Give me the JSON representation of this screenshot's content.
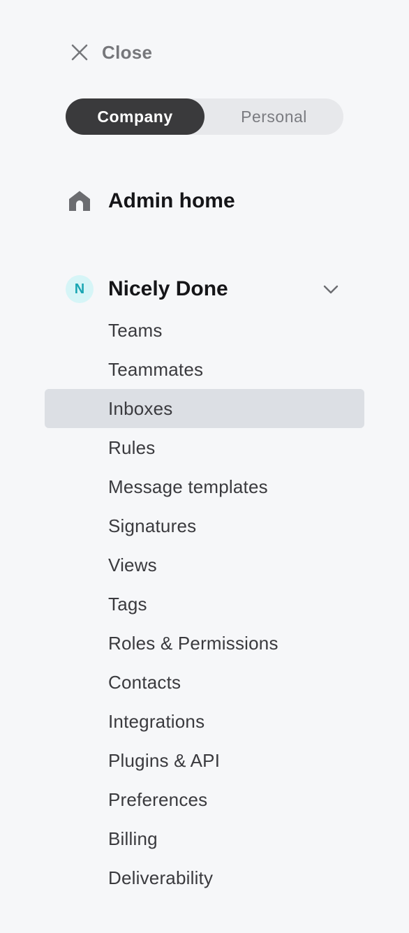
{
  "close": {
    "label": "Close",
    "icon": "close-icon"
  },
  "scope_toggle": {
    "options": [
      "Company",
      "Personal"
    ],
    "selected": "Company"
  },
  "admin_home": {
    "label": "Admin home",
    "icon": "home-icon"
  },
  "organization": {
    "avatar_letter": "N",
    "name": "Nicely Done",
    "expanded": true,
    "avatar_bg": "#d6f5f7",
    "avatar_fg": "#1aa6b3"
  },
  "menu": {
    "selected_index": 2,
    "items": [
      "Teams",
      "Teammates",
      "Inboxes",
      "Rules",
      "Message templates",
      "Signatures",
      "Views",
      "Tags",
      "Roles & Permissions",
      "Contacts",
      "Integrations",
      "Plugins & API",
      "Preferences",
      "Billing",
      "Deliverability"
    ]
  },
  "colors": {
    "background": "#f6f7f9",
    "toggle_active": "#3a3a3c",
    "selected_row": "#dcdfe4"
  }
}
